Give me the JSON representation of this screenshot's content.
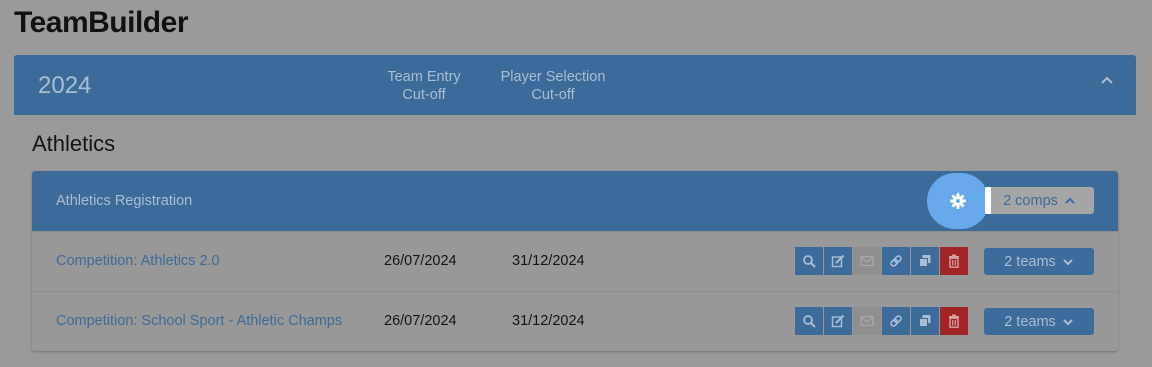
{
  "app": {
    "title": "TeamBuilder"
  },
  "year_panel": {
    "year": "2024",
    "cutoff_headers": [
      {
        "line1": "Team Entry",
        "line2": "Cut-off"
      },
      {
        "line1": "Player Selection",
        "line2": "Cut-off"
      }
    ],
    "collapse_icon": "chevron-up-icon"
  },
  "sport": {
    "title": "Athletics",
    "registration": {
      "title": "Athletics Registration",
      "settings_icon": "gear-icon",
      "comps_label": "2 comps",
      "competitions": [
        {
          "name": "Competition: Athletics 2.0",
          "team_entry_cutoff": "26/07/2024",
          "player_selection_cutoff": "31/12/2024",
          "teams_label": "2 teams"
        },
        {
          "name": "Competition: School Sport - Athletic Champs",
          "team_entry_cutoff": "26/07/2024",
          "player_selection_cutoff": "31/12/2024",
          "teams_label": "2 teams"
        }
      ],
      "row_action_icons": [
        "search-icon",
        "edit-icon",
        "email-icon",
        "link-icon",
        "copy-icon",
        "trash-icon"
      ]
    }
  },
  "colors": {
    "header_blue": "#3c6b99",
    "gear_highlight": "#68a9ec",
    "danger": "#a12526",
    "disabled": "#8f8f8f"
  }
}
